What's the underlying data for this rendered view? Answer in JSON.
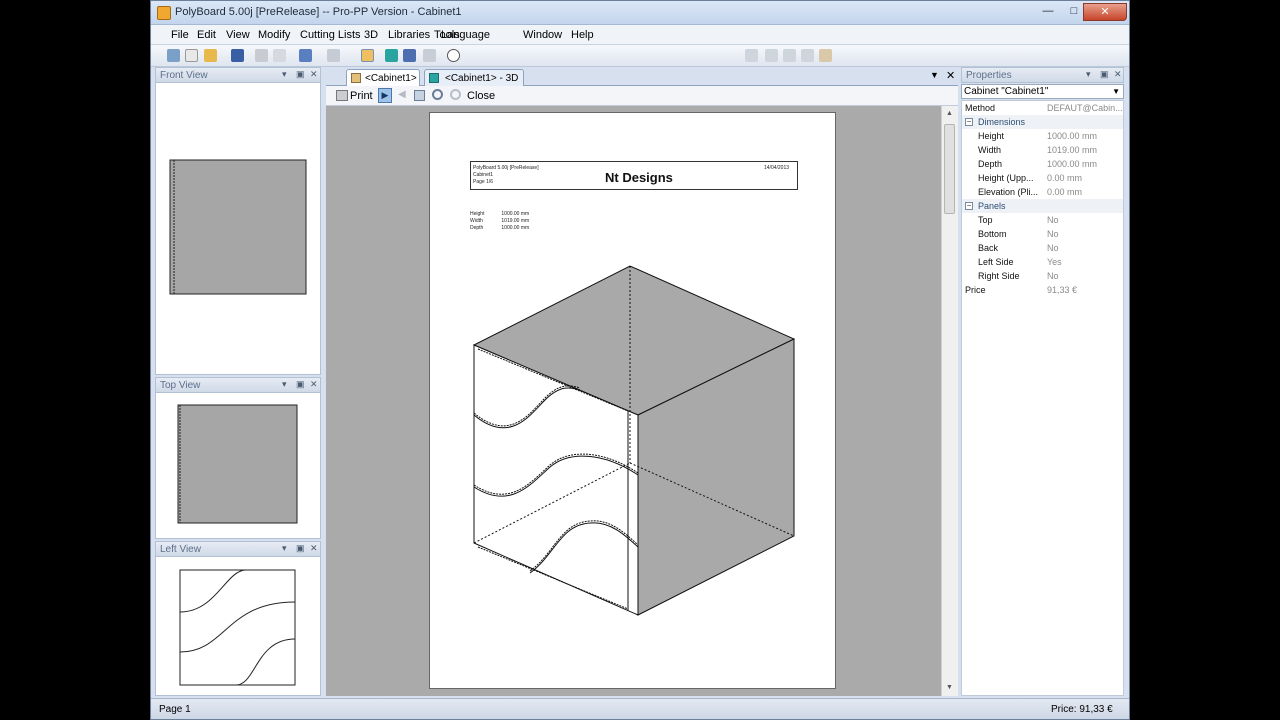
{
  "window": {
    "title": "PolyBoard 5.00j [PreRelease] -- Pro-PP Version - Cabinet1",
    "minimize": "—",
    "maximize": "□",
    "close": "✕"
  },
  "menu": [
    "File",
    "Edit",
    "View",
    "Modify",
    "Cutting Lists",
    "3D",
    "Libraries",
    "Tools",
    "Language",
    "Window",
    "Help"
  ],
  "panels": {
    "front": "Front View",
    "top": "Top View",
    "left": "Left View",
    "pin": "▾",
    "dock": "▣",
    "close": "✕"
  },
  "tabs": [
    {
      "label": "<Cabinet1>"
    },
    {
      "label": "<Cabinet1> - 3D"
    }
  ],
  "preview_toolbar": {
    "print": "Print",
    "close": "Close"
  },
  "page": {
    "software": "PolyBoard 5.00j [PreRelease]",
    "cabinet": "Cabinet1",
    "page_no": "Page 1/6",
    "brand": "Nt Designs",
    "date": "14/04/2013",
    "dims": [
      {
        "label": "Height",
        "value": "1000.00 mm"
      },
      {
        "label": "Width",
        "value": "1019.00 mm"
      },
      {
        "label": "Depth",
        "value": "1000.00 mm"
      }
    ]
  },
  "properties": {
    "title": "Properties",
    "selector": "Cabinet \"Cabinet1\"",
    "method_label": "Method",
    "method_value": "DEFAUT@Cabin...",
    "dimensions_label": "Dimensions",
    "height_label": "Height",
    "height_value": "1000.00 mm",
    "width_label": "Width",
    "width_value": "1019.00 mm",
    "depth_label": "Depth",
    "depth_value": "1000.00 mm",
    "height_upp_label": "Height (Upp...",
    "height_upp_value": "0.00 mm",
    "elevation_label": "Elevation (Pli...",
    "elevation_value": "0.00 mm",
    "panels_label": "Panels",
    "top_label": "Top",
    "top_value": "No",
    "bottom_label": "Bottom",
    "bottom_value": "No",
    "back_label": "Back",
    "back_value": "No",
    "left_label": "Left Side",
    "left_value": "Yes",
    "right_label": "Right Side",
    "right_value": "No",
    "price_label": "Price",
    "price_value": "91,33 €",
    "collapse": "−"
  },
  "status": {
    "page": "Page 1",
    "price": "Price: 91,33 €"
  }
}
